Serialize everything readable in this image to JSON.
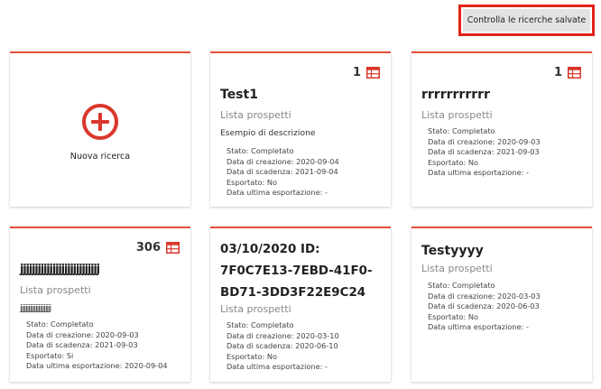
{
  "header": {
    "saved_searches_button": "Controlla le ricerche salvate"
  },
  "new_search": {
    "label": "Nuova ricerca"
  },
  "cards": [
    {
      "count": "1",
      "title": [
        "Test1"
      ],
      "subtitle": "Lista prospetti",
      "description": "Esempio di descrizione",
      "meta": [
        "Stato: Completato",
        "Data di creazione: 2020-09-04",
        "Data di scadenza: 2021-09-04",
        "Esportato: No",
        "Data ultima esportazione: -"
      ]
    },
    {
      "count": "1",
      "title": [
        "rrrrrrrrrrr"
      ],
      "subtitle": "Lista prospetti",
      "description": "",
      "meta": [
        "Stato: Completato",
        "Data di creazione: 2020-09-03",
        "Data di scadenza: 2021-09-03",
        "Esportato: No",
        "Data ultima esportazione: -"
      ]
    },
    {
      "count": "306",
      "title": [
        "jjjjjjjjjjjjjjjjjjjjjjjjjjj"
      ],
      "subtitle": "Lista prospetti",
      "description": "jjjjjjjjjjjjjjjjjjjjjj",
      "meta": [
        "Stato: Completato",
        "Data di creazione: 2020-09-03",
        "Data di scadenza: 2021-09-03",
        "Esportato: Si",
        "Data ultima esportazione: 2020-09-04"
      ]
    },
    {
      "count": "",
      "title": [
        "03/10/2020 ID:",
        "7F0C7E13-7EBD-41F0-",
        "BD71-3DD3F22E9C24"
      ],
      "subtitle": "Lista prospetti",
      "description": "",
      "meta": [
        "Stato: Completato",
        "Data di creazione: 2020-03-10",
        "Data di scadenza: 2020-06-10",
        "Esportato: No",
        "Data ultima esportazione: -"
      ]
    },
    {
      "count": "",
      "title": [
        "Testyyyy"
      ],
      "subtitle": "Lista prospetti",
      "description": "",
      "meta": [
        "Stato: Completato",
        "Data di creazione: 2020-03-03",
        "Data di scadenza: 2020-06-03",
        "Esportato: No",
        "Data ultima esportazione: -"
      ]
    }
  ],
  "colors": {
    "accent": "#e8503f",
    "icon_red": "#d9372c",
    "highlight_frame": "#e2231a"
  },
  "icons": {
    "new_search": "plus-circle-icon",
    "count": "table-icon"
  }
}
